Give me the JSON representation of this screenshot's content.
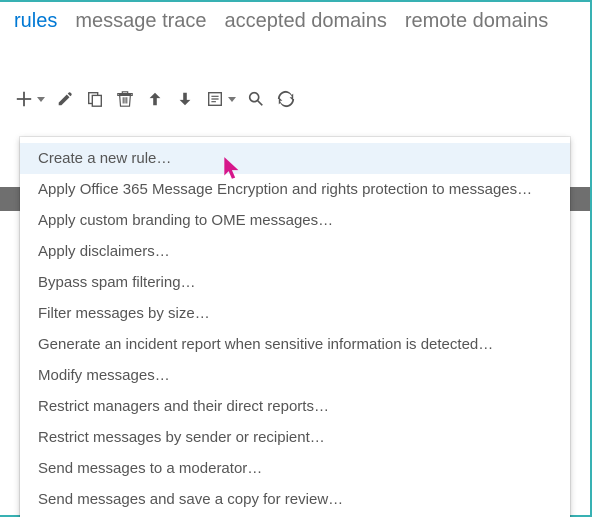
{
  "tabs": {
    "rules": "rules",
    "message_trace": "message trace",
    "accepted_domains": "accepted domains",
    "remote_domains": "remote domains"
  },
  "toolbar": {
    "new": "New",
    "edit": "Edit",
    "copy": "Copy",
    "delete": "Delete",
    "move_up": "Move up",
    "move_down": "Move down",
    "export": "Export",
    "search": "Search",
    "refresh": "Refresh"
  },
  "menu": {
    "items": [
      "Create a new rule…",
      "Apply Office 365 Message Encryption and rights protection to messages…",
      "Apply custom branding to OME messages…",
      "Apply disclaimers…",
      "Bypass spam filtering…",
      "Filter messages by size…",
      "Generate an incident report when sensitive information is detected…",
      "Modify messages…",
      "Restrict managers and their direct reports…",
      "Restrict messages by sender or recipient…",
      "Send messages to a moderator…",
      "Send messages and save a copy for review…"
    ],
    "hovered_index": 0
  },
  "colors": {
    "accent_teal": "#38b1b3",
    "link_blue": "#0078d4",
    "cursor_pink": "#d6178a"
  }
}
